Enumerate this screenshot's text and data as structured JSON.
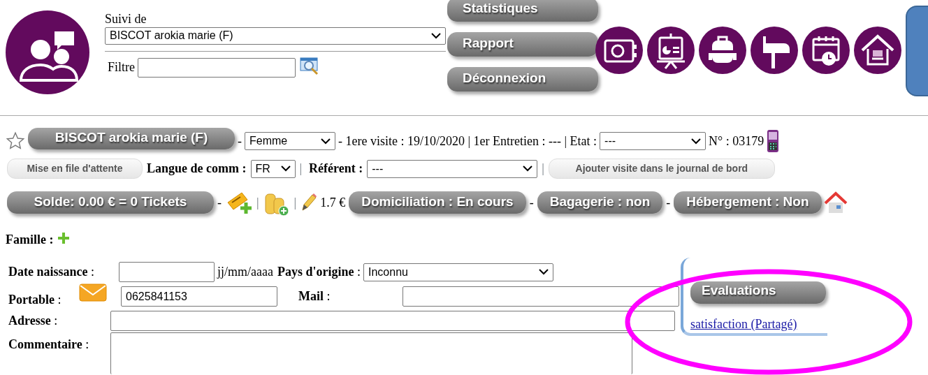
{
  "header": {
    "follow_label": "Suivi de",
    "follow_select": "BISCOT arokia marie (F)",
    "filter_label": "Filtre"
  },
  "nav_buttons": [
    "Statistiques",
    "Rapport",
    "Déconnexion"
  ],
  "shortcut_icons": [
    {
      "kind": "safe"
    },
    {
      "kind": "board"
    },
    {
      "kind": "backpack"
    },
    {
      "kind": "mailbox"
    },
    {
      "kind": "calendar"
    },
    {
      "kind": "house"
    }
  ],
  "person": {
    "favorite": false,
    "name": "BISCOT arokia marie (F)",
    "dash": "-",
    "sex": "Femme",
    "visit_info": "- 1ere visite : 19/10/2020 | 1er Entretien : --- | Etat :",
    "state": "---",
    "number": "N° : 03179"
  },
  "row2": {
    "queue_button": "Mise en file d'attente",
    "language_label": "Langue de comm :",
    "language": "FR",
    "sep1": "|",
    "referent_label": "Référent :",
    "referent": "---",
    "sep2": "|",
    "log_button": "Ajouter visite dans le journal de bord"
  },
  "row3": {
    "balance": "Solde: 0.00 € = 0 Tickets",
    "dash": "-",
    "sep1": "|",
    "sep2": "|",
    "amount": "1.7 €",
    "statuses": [
      {
        "label": "Domiciliation : En cours"
      },
      {
        "label": "Bagagerie : non"
      },
      {
        "label": "Hébergement : Non"
      }
    ],
    "status_sep": "-"
  },
  "family_label": "Famille :",
  "form": [
    [
      {
        "kind": "label",
        "text": "**Date naissance** :"
      },
      {
        "kind": "input"
      },
      {
        "kind": "hint",
        "text": "jj/mm/aaaa"
      },
      {
        "kind": "label",
        "text": "**Pays d'origine** :"
      },
      {
        "kind": "select",
        "value": "Inconnu"
      }
    ],
    [
      {
        "kind": "label",
        "text": "**Portable** :"
      },
      {
        "kind": "mail_icon"
      },
      {
        "kind": "input",
        "value": "0625841153"
      },
      {
        "kind": "label",
        "text": "**Mail** :"
      },
      {
        "kind": "input"
      }
    ],
    [
      {
        "kind": "label",
        "text": "**Adresse** :"
      },
      {
        "kind": "wide"
      }
    ],
    [
      {
        "kind": "label",
        "text": "**Commentaire** :"
      },
      {
        "kind": "textarea"
      }
    ]
  ],
  "evaluations": {
    "title": "Evaluations",
    "links": [
      "satisfaction (Partagé)"
    ]
  },
  "annotation": {
    "kind": "ellipse",
    "color": "#ff00ff"
  }
}
